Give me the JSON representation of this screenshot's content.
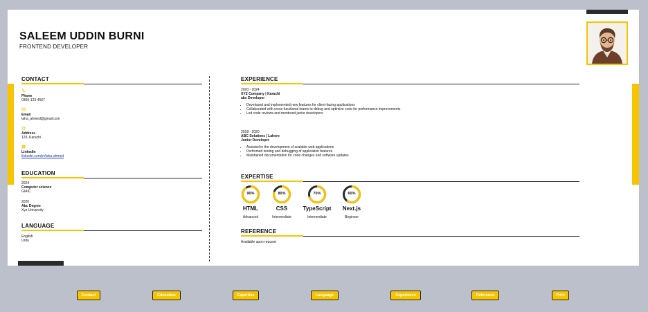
{
  "header": {
    "name": "SALEEM UDDIN BURNI",
    "role": "FRONTEND DEVELOPER"
  },
  "colors": {
    "accent": "#f6c400",
    "dark": "#2a2a2a",
    "page_bg": "#bcc0ca"
  },
  "contact": {
    "title": "CONTACT",
    "items": [
      {
        "icon": "phone-icon",
        "label": "Phone",
        "value": "0300-123-4567"
      },
      {
        "icon": "email-icon",
        "label": "Email",
        "value": "taha_ahmed@gmail.com"
      },
      {
        "icon": "home-icon",
        "label": "Address",
        "value": "123, Karachi"
      },
      {
        "icon": "linkedin-icon",
        "label": "LinkedIn",
        "value": "linkedin.com/in/taha-ahmed"
      }
    ]
  },
  "education": {
    "title": "EDUCATION",
    "items": [
      {
        "year": "2024",
        "degree": "Computer science",
        "school": "GIAIC"
      },
      {
        "year": "2020",
        "degree": "Abc Degree",
        "school": "Xyz University"
      }
    ]
  },
  "language": {
    "title": "LANGUAGE",
    "items": [
      "English",
      "Urdu"
    ]
  },
  "experience": {
    "title": "EXPERIENCE",
    "jobs": [
      {
        "period": "2020 - 2024",
        "company": "XYZ Company | Karachi",
        "title": "abc Developer",
        "points": [
          "Developed and implemented new features for client-facing applications",
          "Collaborated with cross-functional teams to debug and optimize code for performance improvements",
          "Led code reviews and mentored junior developers"
        ]
      },
      {
        "period": "2018 - 2020",
        "company": "ABC Solutions | Lahore",
        "title": "Junior Developer",
        "points": [
          "Assisted in the development of scalable web applications",
          "Performed testing and debugging of application features",
          "Maintained documentation for code changes and software updates"
        ]
      }
    ]
  },
  "expertise": {
    "title": "EXPERTISE",
    "skills": [
      {
        "name": "HTML",
        "percent": 90,
        "pct_label": "90%",
        "level": "Advanced"
      },
      {
        "name": "CSS",
        "percent": 80,
        "pct_label": "80%",
        "level": "Intermediate"
      },
      {
        "name": "TypeScript",
        "percent": 70,
        "pct_label": "70%",
        "level": "Intermediate"
      },
      {
        "name": "Next.js",
        "percent": 60,
        "pct_label": "60%",
        "level": "Beginner"
      }
    ]
  },
  "reference": {
    "title": "REFERENCE",
    "text": "Available upon request"
  },
  "nav": {
    "buttons": [
      "Contact",
      "Education",
      "Expertise",
      "Language",
      "Experience",
      "Reference",
      "Print"
    ]
  }
}
